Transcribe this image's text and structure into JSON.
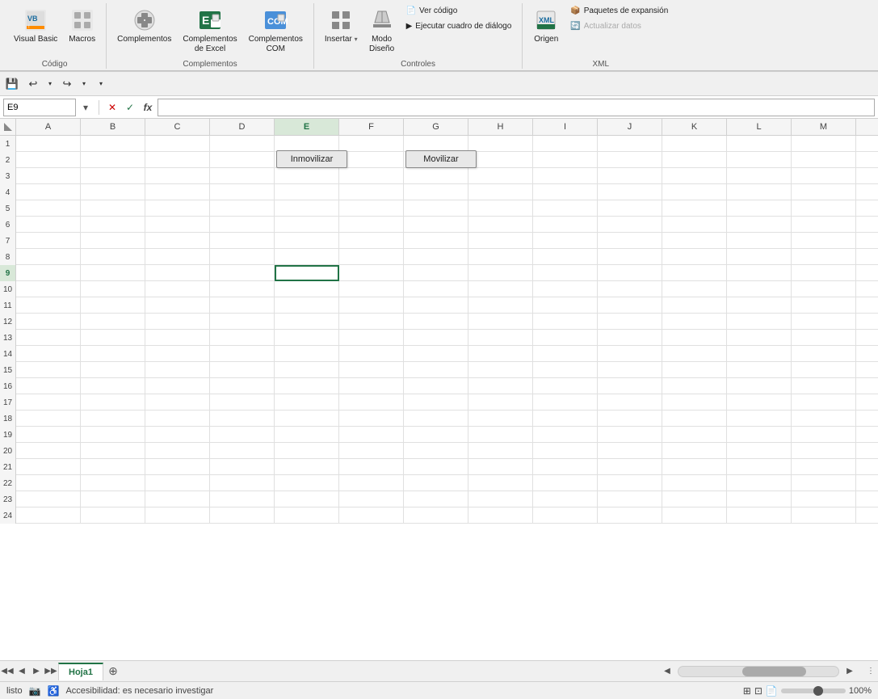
{
  "ribbon": {
    "groups": [
      {
        "name": "Código",
        "label": "Código",
        "buttons": [
          {
            "id": "visual-basic",
            "icon": "📊",
            "label": "Visual\nBasic",
            "has_warning": true
          },
          {
            "id": "macros",
            "icon": "⊞",
            "label": "Macros",
            "has_warning": false
          }
        ]
      },
      {
        "name": "Complementos",
        "label": "Complementos",
        "buttons": [
          {
            "id": "complementos",
            "icon": "🔌",
            "label": "Complementos"
          },
          {
            "id": "complementos-excel",
            "icon": "📦",
            "label": "Complementos\nde Excel"
          },
          {
            "id": "complementos-com",
            "icon": "📦",
            "label": "Complementos\nCOM"
          }
        ]
      },
      {
        "name": "Controles",
        "label": "Controles",
        "buttons": [
          {
            "id": "insertar",
            "icon": "▣",
            "label": "Insertar",
            "has_dropdown": true
          },
          {
            "id": "modo-diseno",
            "icon": "✏️",
            "label": "Modo\nDiseño"
          }
        ],
        "side_buttons": [
          {
            "id": "ver-codigo",
            "icon": "📄",
            "label": "Ver código"
          },
          {
            "id": "ejecutar-cuadro",
            "icon": "▶",
            "label": "Ejecutar cuadro de diálogo"
          }
        ]
      },
      {
        "name": "XML",
        "label": "XML",
        "buttons": [
          {
            "id": "origen",
            "icon": "🗂️",
            "label": "Origen"
          }
        ],
        "side_buttons": [
          {
            "id": "paquetes-expansion",
            "icon": "📦",
            "label": "Paquetes de expansión"
          },
          {
            "id": "actualizar-datos",
            "icon": "🔄",
            "label": "Actualizar datos",
            "disabled": true
          }
        ]
      }
    ]
  },
  "quick_access": {
    "buttons": [
      {
        "id": "save",
        "icon": "💾",
        "label": "Guardar"
      },
      {
        "id": "undo",
        "icon": "↩",
        "label": "Deshacer"
      },
      {
        "id": "redo",
        "icon": "↪",
        "label": "Rehacer"
      },
      {
        "id": "customize",
        "icon": "▾",
        "label": "Personalizar"
      }
    ]
  },
  "formula_bar": {
    "cell_ref": "E9",
    "formula_placeholder": "",
    "cancel_label": "✕",
    "confirm_label": "✓",
    "formula_label": "fx"
  },
  "spreadsheet": {
    "columns": [
      "A",
      "B",
      "C",
      "D",
      "E",
      "F",
      "G",
      "H",
      "I",
      "J",
      "K",
      "L",
      "M"
    ],
    "rows": 24,
    "selected_cell": "E9",
    "buttons": [
      {
        "id": "inmovilizar",
        "label": "Inmovilizar",
        "row": 2,
        "col": 5
      },
      {
        "id": "movilizar",
        "label": "Movilizar",
        "row": 2,
        "col": 7
      }
    ]
  },
  "sheet_tabs": [
    {
      "id": "hoja1",
      "label": "Hoja1",
      "active": true
    }
  ],
  "status_bar": {
    "status": "listo",
    "accessibility": "Accesibilidad: es necesario investigar",
    "icons": [
      "camera",
      "accessibility",
      "chart"
    ],
    "zoom": "100%"
  },
  "colors": {
    "excel_green": "#217346",
    "ribbon_bg": "#f0f0f0",
    "header_bg": "#f5f5f5",
    "cell_border": "#e0e0e0",
    "selected_border": "#217346",
    "button_bg": "#e8e8e8",
    "disabled_color": "#aaa"
  }
}
